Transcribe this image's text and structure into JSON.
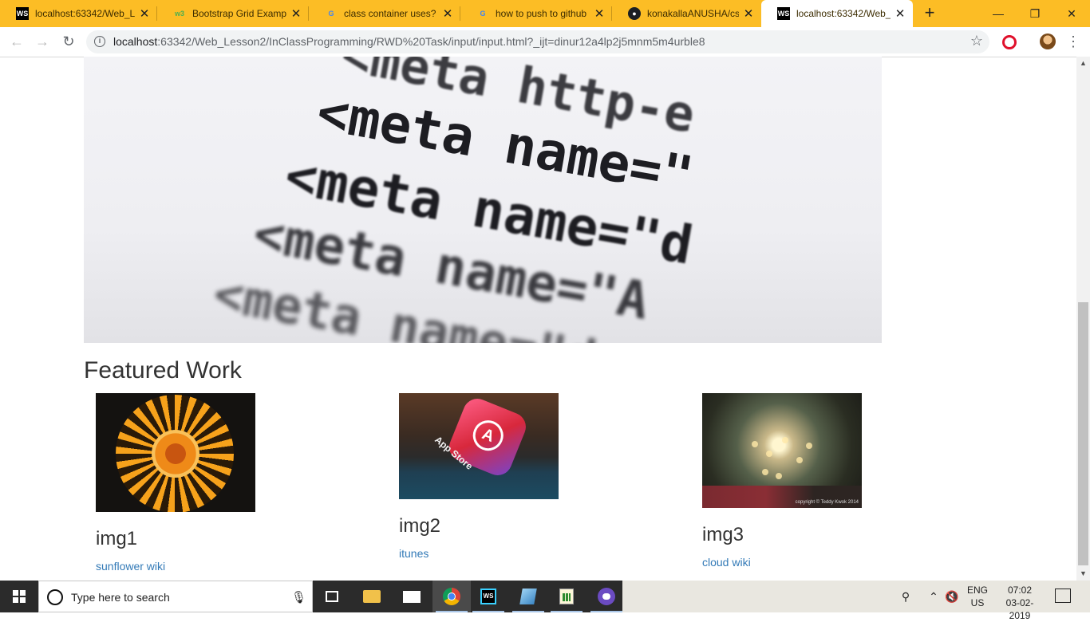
{
  "browser": {
    "tabs": [
      {
        "title": "localhost:63342/Web_L",
        "favicon": "webstorm-icon",
        "active": false
      },
      {
        "title": "Bootstrap Grid Example",
        "favicon": "w3schools-icon",
        "active": false
      },
      {
        "title": "class container uses? - G",
        "favicon": "google-icon",
        "active": false
      },
      {
        "title": "how to push to github",
        "favicon": "google-icon",
        "active": false
      },
      {
        "title": "konakallaANUSHA/csee",
        "favicon": "github-icon",
        "active": false
      },
      {
        "title": "localhost:63342/Web_L",
        "favicon": "webstorm-icon",
        "active": true
      }
    ],
    "new_tab_label": "+",
    "window_controls": {
      "minimize": "—",
      "maximize": "❐",
      "close": "✕"
    },
    "nav": {
      "back": "←",
      "forward": "→",
      "reload": "↻"
    },
    "url_host": "localhost",
    "url_rest": ":63342/Web_Lesson2/InClassProgramming/RWD%20Task/input/input.html?_ijt=dinur12a4lp2j5mnm5m4urble8",
    "star": "☆",
    "menu": "⋮",
    "accent_color": "#fcbd25"
  },
  "page": {
    "hero_lines": [
      "<meta http-e",
      "<meta name=\"",
      "<meta name=\"d",
      "<meta name=\"A",
      "<meta name=\"d"
    ],
    "section_title": "Featured Work",
    "cards": [
      {
        "caption": "img1",
        "link": "sunflower wiki",
        "image": "sunflower-image"
      },
      {
        "caption": "img2",
        "link": "itunes",
        "image": "app-store-image"
      },
      {
        "caption": "img3",
        "link": "cloud wiki",
        "image": "bokeh-lights-image"
      }
    ],
    "image3_credit": "copyright © Teddy Kwok 2014",
    "app_store_text": "App Store",
    "link_color": "#337ab7"
  },
  "taskbar": {
    "search_placeholder": "Type here to search",
    "apps": [
      "task-view-icon",
      "file-explorer-icon",
      "mail-icon",
      "chrome-icon",
      "webstorm-icon",
      "notepad-icon",
      "spreadsheet-icon",
      "github-desktop-icon"
    ],
    "lang_line1": "ENG",
    "lang_line2": "US",
    "time": "07:02",
    "date": "03-02-2019"
  }
}
